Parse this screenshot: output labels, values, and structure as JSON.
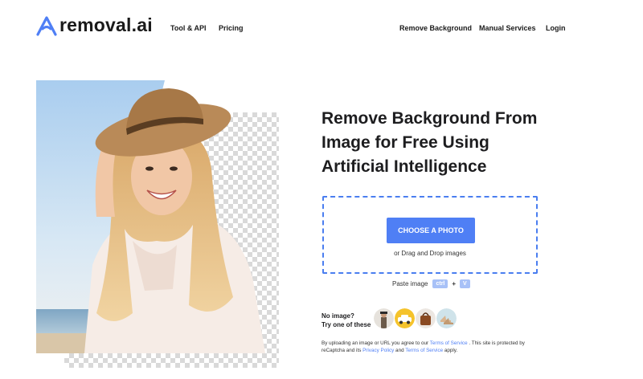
{
  "brand": {
    "name": "removal.ai",
    "accent": "#4f7ff5"
  },
  "nav": {
    "left": [
      "Tool & API",
      "Pricing"
    ],
    "right": [
      "Remove Background",
      "Manual Services",
      "Login"
    ]
  },
  "hero": {
    "headline_lines": [
      "Remove Background From",
      "Image for Free Using",
      "Artificial Intelligence"
    ]
  },
  "upload": {
    "button_label": "CHOOSE A PHOTO",
    "drag_text": "or Drag and Drop images",
    "paste_label": "Paste image",
    "key_ctrl": "ctrl",
    "key_plus": "+",
    "key_v": "V"
  },
  "samples": {
    "prompt_line1": "No image?",
    "prompt_line2": "Try one of these",
    "items": [
      "sample-person",
      "sample-car",
      "sample-bag",
      "sample-shoes"
    ]
  },
  "terms": {
    "t1": "By uploading an image or URL you agree to our ",
    "tos_link": "Terms of Service",
    "t2": " . This site is protected by reCaptcha and its ",
    "privacy_link": "Privacy Policy",
    "t3": " and ",
    "tos_link2": "Terms of Service",
    "t4": " apply."
  }
}
